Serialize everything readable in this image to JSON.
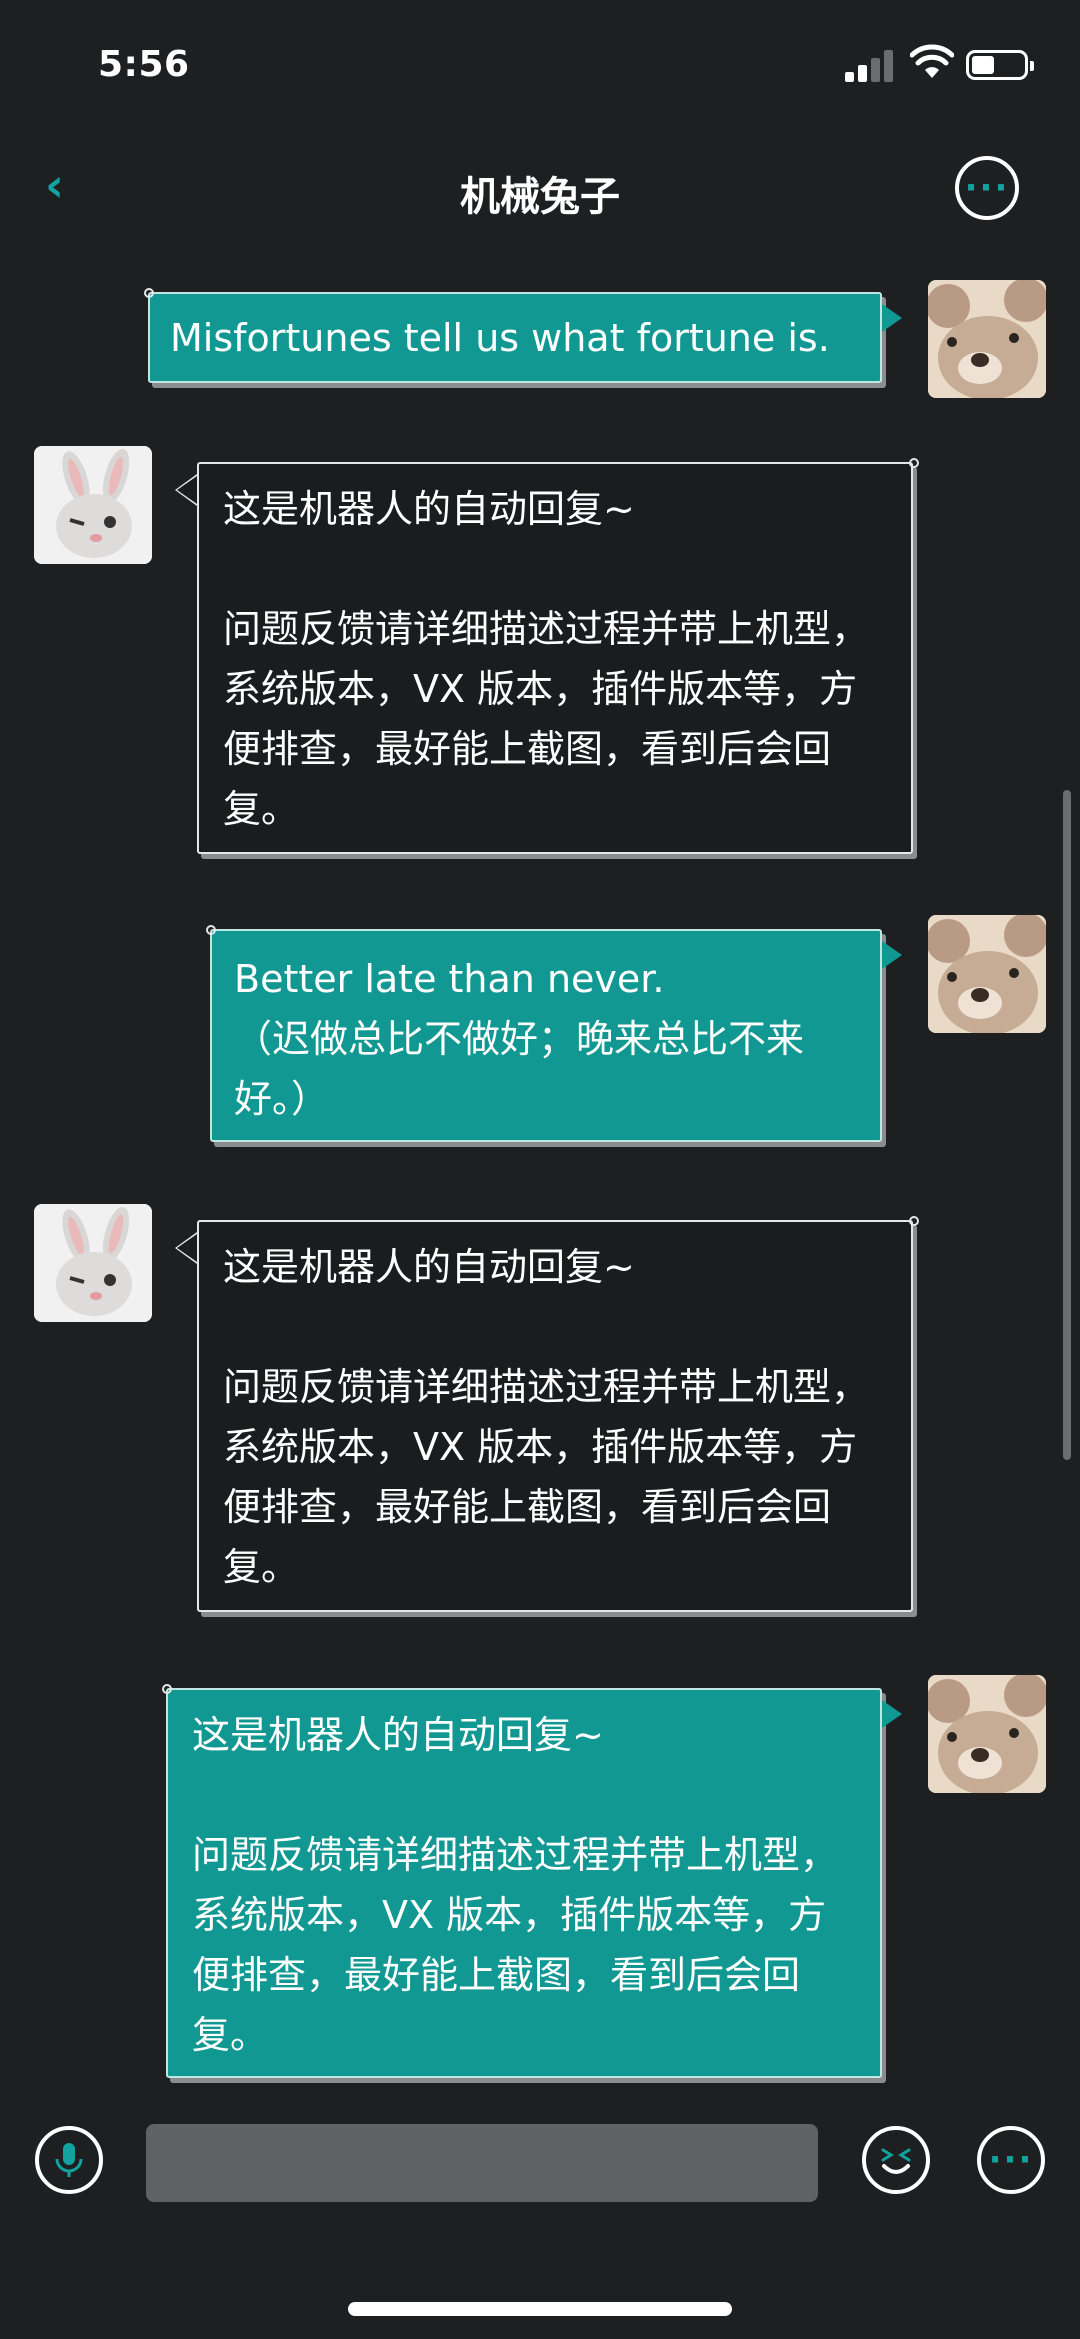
{
  "status": {
    "time": "5:56"
  },
  "header": {
    "title": "机械兔子",
    "back_icon": "chevron-left-icon",
    "more_icon": "more-dots-icon"
  },
  "messages": [
    {
      "side": "right",
      "avatar": "bear-avatar",
      "text": "Misfortunes tell us what fortune is."
    },
    {
      "side": "left",
      "avatar": "rabbit-avatar",
      "text": "这是机器人的自动回复~\n\n问题反馈请详细描述过程并带上机型，系统版本，VX 版本，插件版本等，方便排查，最好能上截图，看到后会回复。"
    },
    {
      "side": "right",
      "avatar": "bear-avatar",
      "text": "Better late than never.\n（迟做总比不做好；晚来总比不来好。）"
    },
    {
      "side": "left",
      "avatar": "rabbit-avatar",
      "text": "这是机器人的自动回复~\n\n问题反馈请详细描述过程并带上机型，系统版本，VX 版本，插件版本等，方便排查，最好能上截图，看到后会回复。"
    },
    {
      "side": "right",
      "avatar": "bear-avatar",
      "text": "这是机器人的自动回复~\n\n问题反馈请详细描述过程并带上机型，系统版本，VX 版本，插件版本等，方便排查，最好能上截图，看到后会回复。"
    }
  ],
  "inputbar": {
    "voice_icon": "microphone-icon",
    "emoji_icon": "emoji-icon",
    "more_icon": "more-dots-icon",
    "input_value": ""
  },
  "colors": {
    "accent": "#129892",
    "background": "#1d1f21"
  }
}
